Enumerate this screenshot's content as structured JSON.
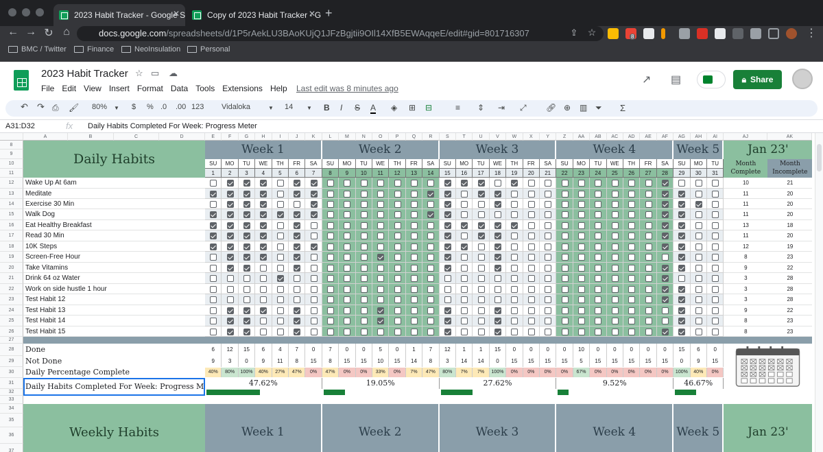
{
  "browser": {
    "tabs": [
      {
        "title": "2023 Habit Tracker - Google Sh"
      },
      {
        "title": "Copy of 2023 Habit Tracker - G"
      }
    ],
    "url_domain": "docs.google.com",
    "url_path": "/spreadsheets/d/1P5rAekLU3BAoKUjQ1JFzBgjtii9OIl14XfB5EWAqqeE/edit#gid=801716307",
    "bookmarks": [
      "BMC / Twitter",
      "Finance",
      "NeoInsulation",
      "Personal"
    ],
    "badge": "8"
  },
  "sheet": {
    "title": "2023 Habit Tracker",
    "menu": [
      "File",
      "Edit",
      "View",
      "Insert",
      "Format",
      "Data",
      "Tools",
      "Extensions",
      "Help"
    ],
    "last_edit": "Last edit was 8 minutes ago",
    "share_label": "Share",
    "zoom": "80%",
    "currency": "$",
    "percent": "%",
    "dec_less": ".0",
    "dec_more": ".00",
    "number_format": "123",
    "font": "Vidaloka",
    "font_size": "14",
    "name_box": "A31:D32",
    "formula": "Daily Habits Completed For Week: Progress Meter"
  },
  "columns": [
    "A",
    "B",
    "C",
    "D",
    "E",
    "F",
    "G",
    "H",
    "I",
    "J",
    "K",
    "L",
    "M",
    "N",
    "O",
    "P",
    "Q",
    "R",
    "S",
    "T",
    "U",
    "V",
    "W",
    "X",
    "Y",
    "Z",
    "AA",
    "AB",
    "AC",
    "AD",
    "AE",
    "AF",
    "AG",
    "AH",
    "AI",
    "AJ",
    "AK"
  ],
  "rows": [
    "8",
    "9",
    "10",
    "11",
    "12",
    "13",
    "14",
    "15",
    "16",
    "17",
    "18",
    "19",
    "20",
    "21",
    "22",
    "23",
    "24",
    "25",
    "26",
    "27",
    "28",
    "29",
    "30",
    "31",
    "32",
    "33",
    "34",
    "35",
    "36",
    "37"
  ],
  "tracker": {
    "daily_title": "Daily Habits",
    "weeks": [
      "Week 1",
      "Week 2",
      "Week 3",
      "Week 4",
      "Week 5"
    ],
    "month": "Jan 23'",
    "month_complete": "Month Complete",
    "month_incomplete": "Month Incomplete",
    "day_names": [
      "SU",
      "MO",
      "TU",
      "WE",
      "TH",
      "FR",
      "SA",
      "SU",
      "MO",
      "TU",
      "WE",
      "TH",
      "FR",
      "SA",
      "SU",
      "MO",
      "TU",
      "WE",
      "TH",
      "FR",
      "SA",
      "SU",
      "MO",
      "TU",
      "WE",
      "TH",
      "FR",
      "SA",
      "SU",
      "MO",
      "TU"
    ],
    "day_nums": [
      "1",
      "2",
      "3",
      "4",
      "5",
      "6",
      "7",
      "8",
      "9",
      "10",
      "11",
      "12",
      "13",
      "14",
      "15",
      "16",
      "17",
      "18",
      "19",
      "20",
      "21",
      "22",
      "23",
      "24",
      "25",
      "26",
      "27",
      "28",
      "29",
      "30",
      "31"
    ],
    "habits": [
      {
        "name": "Wake Up At 6am",
        "complete": "10",
        "incomplete": "21",
        "checks": "0111011000000011101000000001000"
      },
      {
        "name": "Meditate",
        "complete": "11",
        "incomplete": "20",
        "checks": "1111011000000110110000000001100"
      },
      {
        "name": "Exercise 30 Min",
        "complete": "11",
        "incomplete": "20",
        "checks": "0111001000000010010000000001110"
      },
      {
        "name": "Walk Dog",
        "complete": "11",
        "incomplete": "20",
        "checks": "1111111000000110000000000001100"
      },
      {
        "name": "Eat Healthy Breakfast",
        "complete": "13",
        "incomplete": "18",
        "checks": "1111010000000011111000000001100"
      },
      {
        "name": "Read 30 Min",
        "complete": "11",
        "incomplete": "20",
        "checks": "1111010000000010110000000001100"
      },
      {
        "name": "10K Steps",
        "complete": "12",
        "incomplete": "19",
        "checks": "1111011000000011010000000001100"
      },
      {
        "name": "Screen-Free Hour",
        "complete": "8",
        "incomplete": "23",
        "checks": "0111010000100010010000000000100"
      },
      {
        "name": "Take Vitamins",
        "complete": "9",
        "incomplete": "22",
        "checks": "0110010000000010010000000001100"
      },
      {
        "name": "Drink 64 oz Water",
        "complete": "3",
        "incomplete": "28",
        "checks": "0000100000000000000000000001000"
      },
      {
        "name": "Work on side hustle 1 hour",
        "complete": "3",
        "incomplete": "28",
        "checks": "0000000000000000000000000001100"
      },
      {
        "name": "Test Habit 12",
        "complete": "3",
        "incomplete": "28",
        "checks": "0000000000000000000000000001100"
      },
      {
        "name": "Test Habit 13",
        "complete": "9",
        "incomplete": "22",
        "checks": "0111010000100010010000000000100"
      },
      {
        "name": "Test Habit 14",
        "complete": "8",
        "incomplete": "23",
        "checks": "0110010000100010010000000000100"
      },
      {
        "name": "Test Habit 15",
        "complete": "8",
        "incomplete": "23",
        "checks": "0110010000000010010000000001100"
      }
    ],
    "done_label": "Done",
    "not_done_label": "Not Done",
    "pct_label": "Daily Percentage Complete",
    "meter_label": "Daily Habits Completed For Week: Progress Meter",
    "done": [
      "6",
      "12",
      "15",
      "6",
      "4",
      "7",
      "0",
      "7",
      "0",
      "0",
      "5",
      "0",
      "1",
      "7",
      "12",
      "1",
      "1",
      "15",
      "0",
      "0",
      "0",
      "0",
      "10",
      "0",
      "0",
      "0",
      "0",
      "0",
      "15",
      "6",
      "0"
    ],
    "not_done": [
      "9",
      "3",
      "0",
      "9",
      "11",
      "8",
      "15",
      "8",
      "15",
      "15",
      "10",
      "15",
      "14",
      "8",
      "3",
      "14",
      "14",
      "0",
      "15",
      "15",
      "15",
      "15",
      "5",
      "15",
      "15",
      "15",
      "15",
      "15",
      "0",
      "9",
      "15"
    ],
    "pct": [
      "40%",
      "80%",
      "100%",
      "40%",
      "27%",
      "47%",
      "0%",
      "47%",
      "0%",
      "0%",
      "33%",
      "0%",
      "7%",
      "47%",
      "80%",
      "7%",
      "7%",
      "100%",
      "0%",
      "0%",
      "0%",
      "0%",
      "67%",
      "0%",
      "0%",
      "0%",
      "0%",
      "0%",
      "100%",
      "40%",
      "0%"
    ],
    "week_pct": [
      "47.62%",
      "19.05%",
      "27.62%",
      "9.52%",
      "46.67%"
    ],
    "week_fill": [
      0.4762,
      0.1905,
      0.2762,
      0.0952,
      0.4667
    ],
    "weekly_title": "Weekly Habits",
    "colors": {
      "week_header": "#8a9eaa",
      "green": "#8bbf9f",
      "bar": "#188038"
    }
  }
}
